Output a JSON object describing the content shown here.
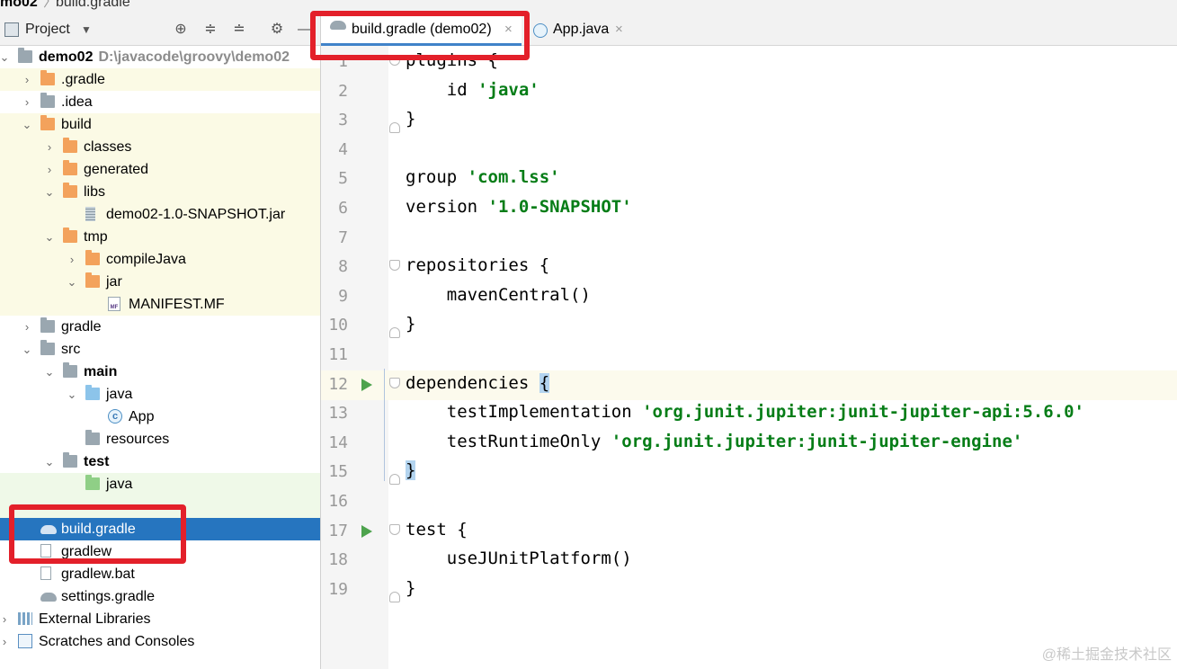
{
  "breadcrumb": {
    "project": "mo02",
    "separator": "〉",
    "file": "build.gradle"
  },
  "project_panel": {
    "title": "Project",
    "toolbar_icons": [
      "target-icon",
      "expand-all-icon",
      "collapse-all-icon",
      "gear-icon",
      "minimize-icon"
    ],
    "tree": [
      {
        "label": "demo02",
        "path": "D:\\javacode\\groovy\\demo02",
        "depth": 0,
        "arrow": "⌄",
        "icon": "folder-gray",
        "bold": true,
        "style": "normal"
      },
      {
        "label": ".gradle",
        "depth": 1,
        "arrow": "›",
        "icon": "folder-orange",
        "style": "excluded"
      },
      {
        "label": ".idea",
        "depth": 1,
        "arrow": "›",
        "icon": "folder-gray",
        "style": "normal"
      },
      {
        "label": "build",
        "depth": 1,
        "arrow": "⌄",
        "icon": "folder-orange",
        "style": "excluded"
      },
      {
        "label": "classes",
        "depth": 2,
        "arrow": "›",
        "icon": "folder-orange",
        "style": "excluded"
      },
      {
        "label": "generated",
        "depth": 2,
        "arrow": "›",
        "icon": "folder-orange",
        "style": "excluded"
      },
      {
        "label": "libs",
        "depth": 2,
        "arrow": "⌄",
        "icon": "folder-orange",
        "style": "excluded"
      },
      {
        "label": "demo02-1.0-SNAPSHOT.jar",
        "depth": 3,
        "arrow": "",
        "icon": "jar",
        "style": "excluded"
      },
      {
        "label": "tmp",
        "depth": 2,
        "arrow": "⌄",
        "icon": "folder-orange",
        "style": "excluded"
      },
      {
        "label": "compileJava",
        "depth": 3,
        "arrow": "›",
        "icon": "folder-orange",
        "style": "excluded"
      },
      {
        "label": "jar",
        "depth": 3,
        "arrow": "⌄",
        "icon": "folder-orange",
        "style": "excluded"
      },
      {
        "label": "MANIFEST.MF",
        "depth": 4,
        "arrow": "",
        "icon": "manifest",
        "style": "excluded"
      },
      {
        "label": "gradle",
        "depth": 1,
        "arrow": "›",
        "icon": "folder-gray",
        "style": "normal"
      },
      {
        "label": "src",
        "depth": 1,
        "arrow": "⌄",
        "icon": "folder-gray",
        "style": "normal"
      },
      {
        "label": "main",
        "depth": 2,
        "arrow": "⌄",
        "icon": "folder-gray",
        "bold": true,
        "style": "normal"
      },
      {
        "label": "java",
        "depth": 3,
        "arrow": "⌄",
        "icon": "folder-blue",
        "style": "normal"
      },
      {
        "label": "App",
        "depth": 4,
        "arrow": "",
        "icon": "class",
        "style": "normal"
      },
      {
        "label": "resources",
        "depth": 3,
        "arrow": "",
        "icon": "folder-gray",
        "style": "normal"
      },
      {
        "label": "test",
        "depth": 2,
        "arrow": "⌄",
        "icon": "folder-gray",
        "bold": true,
        "style": "normal"
      },
      {
        "label": "java",
        "depth": 3,
        "arrow": "",
        "icon": "folder-green",
        "style": "test-root"
      },
      {
        "label": "",
        "depth": 3,
        "arrow": "",
        "icon": "none",
        "style": "test-root"
      },
      {
        "label": "build.gradle",
        "depth": 1,
        "arrow": "",
        "icon": "gradle",
        "style": "selected"
      },
      {
        "label": "gradlew",
        "depth": 1,
        "arrow": "",
        "icon": "file",
        "style": "normal"
      },
      {
        "label": "gradlew.bat",
        "depth": 1,
        "arrow": "",
        "icon": "bat",
        "style": "normal"
      },
      {
        "label": "settings.gradle",
        "depth": 1,
        "arrow": "",
        "icon": "gradle",
        "style": "normal"
      },
      {
        "label": "External Libraries",
        "depth": 0,
        "arrow": "›",
        "icon": "libs",
        "style": "normal"
      },
      {
        "label": "Scratches and Consoles",
        "depth": 0,
        "arrow": "›",
        "icon": "scratch",
        "style": "normal"
      }
    ]
  },
  "editor": {
    "tabs": [
      {
        "label": "build.gradle (demo02)",
        "close": "×",
        "icon": "gradle-icon",
        "active": true
      },
      {
        "label": "App.java",
        "close": "×",
        "icon": "class-icon",
        "active": false
      }
    ],
    "current_line": 12,
    "lines": [
      {
        "n": "1",
        "parts": [
          {
            "t": "plugins {",
            "k": "p"
          }
        ],
        "fold": "open"
      },
      {
        "n": "2",
        "parts": [
          {
            "t": "    id ",
            "k": "p"
          },
          {
            "t": "'java'",
            "k": "s"
          }
        ]
      },
      {
        "n": "3",
        "parts": [
          {
            "t": "}",
            "k": "p"
          }
        ],
        "fold": "close"
      },
      {
        "n": "4",
        "parts": []
      },
      {
        "n": "5",
        "parts": [
          {
            "t": "group ",
            "k": "p"
          },
          {
            "t": "'com.lss'",
            "k": "s"
          }
        ]
      },
      {
        "n": "6",
        "parts": [
          {
            "t": "version ",
            "k": "p"
          },
          {
            "t": "'1.0-SNAPSHOT'",
            "k": "s"
          }
        ]
      },
      {
        "n": "7",
        "parts": []
      },
      {
        "n": "8",
        "parts": [
          {
            "t": "repositories {",
            "k": "p"
          }
        ],
        "fold": "open"
      },
      {
        "n": "9",
        "parts": [
          {
            "t": "    mavenCentral()",
            "k": "p"
          }
        ]
      },
      {
        "n": "10",
        "parts": [
          {
            "t": "}",
            "k": "p"
          }
        ],
        "fold": "close"
      },
      {
        "n": "11",
        "parts": []
      },
      {
        "n": "12",
        "parts": [
          {
            "t": "dependencies ",
            "k": "p"
          },
          {
            "t": "{",
            "k": "h"
          }
        ],
        "fold": "open",
        "run": true
      },
      {
        "n": "13",
        "parts": [
          {
            "t": "    testImplementation ",
            "k": "p"
          },
          {
            "t": "'org.junit.jupiter:junit-jupiter-api:5.6.0'",
            "k": "s"
          }
        ]
      },
      {
        "n": "14",
        "parts": [
          {
            "t": "    testRuntimeOnly ",
            "k": "p"
          },
          {
            "t": "'org.junit.jupiter:junit-jupiter-engine'",
            "k": "s"
          }
        ]
      },
      {
        "n": "15",
        "parts": [
          {
            "t": "}",
            "k": "h"
          }
        ],
        "fold": "close"
      },
      {
        "n": "16",
        "parts": []
      },
      {
        "n": "17",
        "parts": [
          {
            "t": "test {",
            "k": "p"
          }
        ],
        "fold": "open",
        "run": true
      },
      {
        "n": "18",
        "parts": [
          {
            "t": "    useJUnitPlatform()",
            "k": "p"
          }
        ]
      },
      {
        "n": "19",
        "parts": [
          {
            "t": "}",
            "k": "p"
          }
        ],
        "fold": "close"
      }
    ]
  },
  "colors": {
    "selection": "#2675bf",
    "annotation": "#e3202a",
    "string": "#067d17",
    "excluded_bg": "#fbfae5",
    "test_bg": "#eff9e8"
  },
  "watermark": "@稀土掘金技术社区"
}
